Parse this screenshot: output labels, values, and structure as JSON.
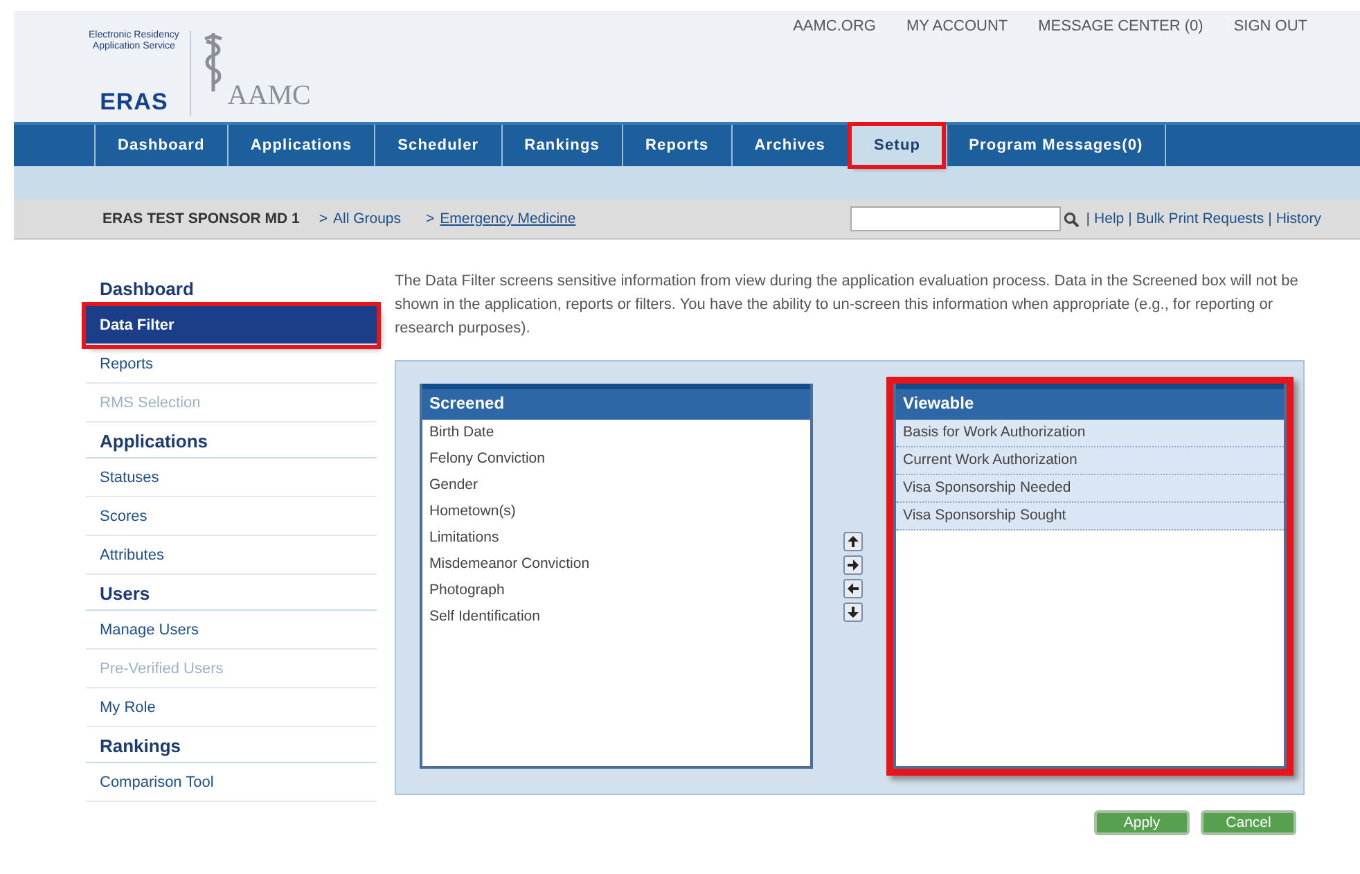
{
  "logo": {
    "tagline_1": "Electronic Residency",
    "tagline_2": "Application Service",
    "brand": "ERAS",
    "org": "AAMC"
  },
  "top_links": [
    "AAMC.ORG",
    "MY ACCOUNT",
    "MESSAGE CENTER (0)",
    "SIGN OUT"
  ],
  "tabs": [
    {
      "label": "Dashboard",
      "selected": false,
      "highlighted": false
    },
    {
      "label": "Applications",
      "selected": false,
      "highlighted": false
    },
    {
      "label": "Scheduler",
      "selected": false,
      "highlighted": false
    },
    {
      "label": "Rankings",
      "selected": false,
      "highlighted": false
    },
    {
      "label": "Reports",
      "selected": false,
      "highlighted": false
    },
    {
      "label": "Archives",
      "selected": false,
      "highlighted": false
    },
    {
      "label": "Setup",
      "selected": true,
      "highlighted": true
    },
    {
      "label": "Program Messages(0)",
      "selected": false,
      "highlighted": false
    }
  ],
  "breadcrumb": {
    "sponsor": "ERAS TEST SPONSOR MD 1",
    "items": [
      {
        "sep": ">",
        "label": "All Groups",
        "underlined": false
      },
      {
        "sep": ">",
        "label": "Emergency Medicine",
        "underlined": true
      }
    ]
  },
  "utility_links": [
    {
      "sep": "|",
      "label": "Help"
    },
    {
      "sep": "|",
      "label": "Bulk Print Requests"
    },
    {
      "sep": "|",
      "label": "History"
    }
  ],
  "sidebar": [
    {
      "heading": "Dashboard",
      "items": [
        {
          "label": "Data Filter",
          "selected": true,
          "disabled": false,
          "highlighted": true
        },
        {
          "label": "Reports",
          "selected": false,
          "disabled": false,
          "highlighted": false
        },
        {
          "label": "RMS Selection",
          "selected": false,
          "disabled": true,
          "highlighted": false
        }
      ]
    },
    {
      "heading": "Applications",
      "items": [
        {
          "label": "Statuses",
          "selected": false,
          "disabled": false,
          "highlighted": false
        },
        {
          "label": "Scores",
          "selected": false,
          "disabled": false,
          "highlighted": false
        },
        {
          "label": "Attributes",
          "selected": false,
          "disabled": false,
          "highlighted": false
        }
      ]
    },
    {
      "heading": "Users",
      "items": [
        {
          "label": "Manage Users",
          "selected": false,
          "disabled": false,
          "highlighted": false
        },
        {
          "label": "Pre-Verified Users",
          "selected": false,
          "disabled": true,
          "highlighted": false
        },
        {
          "label": "My Role",
          "selected": false,
          "disabled": false,
          "highlighted": false
        }
      ]
    },
    {
      "heading": "Rankings",
      "items": [
        {
          "label": "Comparison Tool",
          "selected": false,
          "disabled": false,
          "highlighted": false
        }
      ]
    }
  ],
  "description": "The Data Filter screens sensitive information from view during the application evaluation process. Data in the Screened box will not be shown in the application, reports or filters. You have the ability to un-screen this information when appropriate (e.g., for reporting or research purposes).",
  "screened": {
    "title": "Screened",
    "highlighted": false,
    "items": [
      {
        "label": "Birth Date",
        "selected": false
      },
      {
        "label": "Felony Conviction",
        "selected": false
      },
      {
        "label": "Gender",
        "selected": false
      },
      {
        "label": "Hometown(s)",
        "selected": false
      },
      {
        "label": "Limitations",
        "selected": false
      },
      {
        "label": "Misdemeanor Conviction",
        "selected": false
      },
      {
        "label": "Photograph",
        "selected": false
      },
      {
        "label": "Self Identification",
        "selected": false
      }
    ]
  },
  "viewable": {
    "title": "Viewable",
    "highlighted": true,
    "items": [
      {
        "label": "Basis for Work Authorization",
        "selected": true
      },
      {
        "label": "Current Work Authorization",
        "selected": true
      },
      {
        "label": "Visa Sponsorship Needed",
        "selected": true
      },
      {
        "label": "Visa Sponsorship Sought",
        "selected": true
      }
    ]
  },
  "move_buttons": [
    {
      "kind": "up"
    },
    {
      "kind": "right"
    },
    {
      "kind": "left"
    },
    {
      "kind": "down"
    }
  ],
  "buttons": [
    "Apply",
    "Cancel"
  ]
}
